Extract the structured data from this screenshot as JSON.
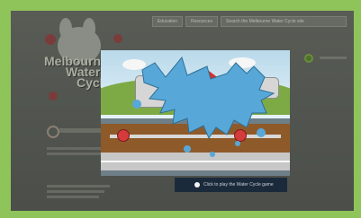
{
  "site": {
    "logo_text": [
      "Melbourne",
      "Water",
      "Cycle"
    ],
    "logo_alt": "Melbourne Water Cycle"
  },
  "top_nav": {
    "items": [
      "Education",
      "Resources",
      "Search the Melbourne Water Cycle site"
    ]
  },
  "modal": {
    "caption": "Click to play the Water Cycle game"
  },
  "colors": {
    "outer_bg": "#8fc45a",
    "overlay": "#4a4d48",
    "splash_blue": "#57a8d8",
    "caption_bg": "#1b2a3a"
  },
  "icons": {
    "splash": "water-splash-icon",
    "house": "house-icon",
    "valve": "valve-icon",
    "caption_dot": "play-dot-icon"
  }
}
